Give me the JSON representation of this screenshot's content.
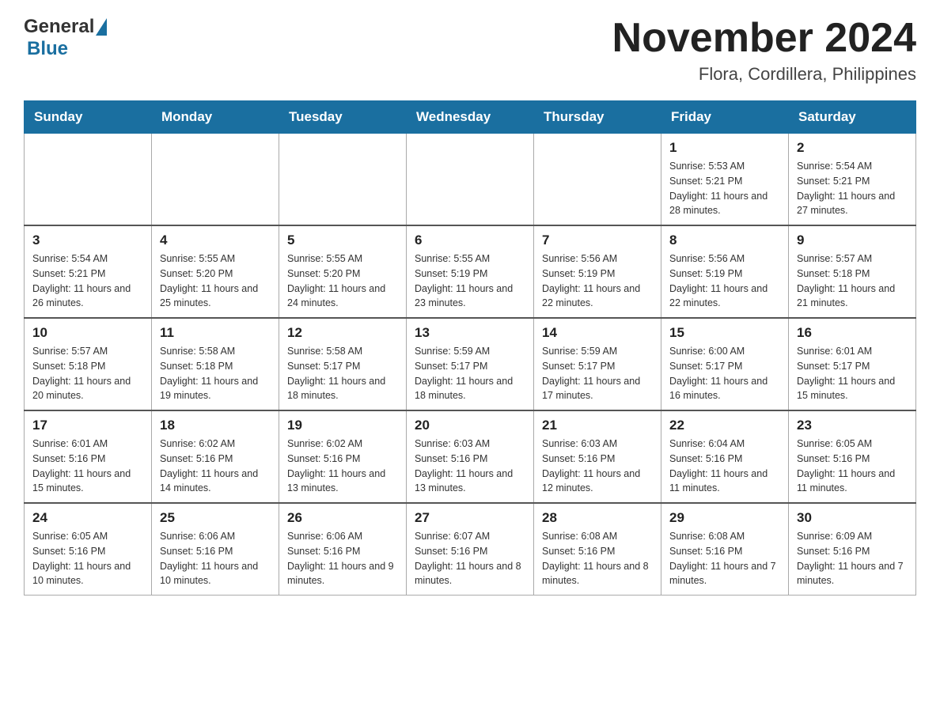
{
  "header": {
    "logo_general": "General",
    "logo_blue": "Blue",
    "month_title": "November 2024",
    "subtitle": "Flora, Cordillera, Philippines"
  },
  "weekdays": [
    "Sunday",
    "Monday",
    "Tuesday",
    "Wednesday",
    "Thursday",
    "Friday",
    "Saturday"
  ],
  "weeks": [
    [
      {
        "day": "",
        "info": ""
      },
      {
        "day": "",
        "info": ""
      },
      {
        "day": "",
        "info": ""
      },
      {
        "day": "",
        "info": ""
      },
      {
        "day": "",
        "info": ""
      },
      {
        "day": "1",
        "info": "Sunrise: 5:53 AM\nSunset: 5:21 PM\nDaylight: 11 hours and 28 minutes."
      },
      {
        "day": "2",
        "info": "Sunrise: 5:54 AM\nSunset: 5:21 PM\nDaylight: 11 hours and 27 minutes."
      }
    ],
    [
      {
        "day": "3",
        "info": "Sunrise: 5:54 AM\nSunset: 5:21 PM\nDaylight: 11 hours and 26 minutes."
      },
      {
        "day": "4",
        "info": "Sunrise: 5:55 AM\nSunset: 5:20 PM\nDaylight: 11 hours and 25 minutes."
      },
      {
        "day": "5",
        "info": "Sunrise: 5:55 AM\nSunset: 5:20 PM\nDaylight: 11 hours and 24 minutes."
      },
      {
        "day": "6",
        "info": "Sunrise: 5:55 AM\nSunset: 5:19 PM\nDaylight: 11 hours and 23 minutes."
      },
      {
        "day": "7",
        "info": "Sunrise: 5:56 AM\nSunset: 5:19 PM\nDaylight: 11 hours and 22 minutes."
      },
      {
        "day": "8",
        "info": "Sunrise: 5:56 AM\nSunset: 5:19 PM\nDaylight: 11 hours and 22 minutes."
      },
      {
        "day": "9",
        "info": "Sunrise: 5:57 AM\nSunset: 5:18 PM\nDaylight: 11 hours and 21 minutes."
      }
    ],
    [
      {
        "day": "10",
        "info": "Sunrise: 5:57 AM\nSunset: 5:18 PM\nDaylight: 11 hours and 20 minutes."
      },
      {
        "day": "11",
        "info": "Sunrise: 5:58 AM\nSunset: 5:18 PM\nDaylight: 11 hours and 19 minutes."
      },
      {
        "day": "12",
        "info": "Sunrise: 5:58 AM\nSunset: 5:17 PM\nDaylight: 11 hours and 18 minutes."
      },
      {
        "day": "13",
        "info": "Sunrise: 5:59 AM\nSunset: 5:17 PM\nDaylight: 11 hours and 18 minutes."
      },
      {
        "day": "14",
        "info": "Sunrise: 5:59 AM\nSunset: 5:17 PM\nDaylight: 11 hours and 17 minutes."
      },
      {
        "day": "15",
        "info": "Sunrise: 6:00 AM\nSunset: 5:17 PM\nDaylight: 11 hours and 16 minutes."
      },
      {
        "day": "16",
        "info": "Sunrise: 6:01 AM\nSunset: 5:17 PM\nDaylight: 11 hours and 15 minutes."
      }
    ],
    [
      {
        "day": "17",
        "info": "Sunrise: 6:01 AM\nSunset: 5:16 PM\nDaylight: 11 hours and 15 minutes."
      },
      {
        "day": "18",
        "info": "Sunrise: 6:02 AM\nSunset: 5:16 PM\nDaylight: 11 hours and 14 minutes."
      },
      {
        "day": "19",
        "info": "Sunrise: 6:02 AM\nSunset: 5:16 PM\nDaylight: 11 hours and 13 minutes."
      },
      {
        "day": "20",
        "info": "Sunrise: 6:03 AM\nSunset: 5:16 PM\nDaylight: 11 hours and 13 minutes."
      },
      {
        "day": "21",
        "info": "Sunrise: 6:03 AM\nSunset: 5:16 PM\nDaylight: 11 hours and 12 minutes."
      },
      {
        "day": "22",
        "info": "Sunrise: 6:04 AM\nSunset: 5:16 PM\nDaylight: 11 hours and 11 minutes."
      },
      {
        "day": "23",
        "info": "Sunrise: 6:05 AM\nSunset: 5:16 PM\nDaylight: 11 hours and 11 minutes."
      }
    ],
    [
      {
        "day": "24",
        "info": "Sunrise: 6:05 AM\nSunset: 5:16 PM\nDaylight: 11 hours and 10 minutes."
      },
      {
        "day": "25",
        "info": "Sunrise: 6:06 AM\nSunset: 5:16 PM\nDaylight: 11 hours and 10 minutes."
      },
      {
        "day": "26",
        "info": "Sunrise: 6:06 AM\nSunset: 5:16 PM\nDaylight: 11 hours and 9 minutes."
      },
      {
        "day": "27",
        "info": "Sunrise: 6:07 AM\nSunset: 5:16 PM\nDaylight: 11 hours and 8 minutes."
      },
      {
        "day": "28",
        "info": "Sunrise: 6:08 AM\nSunset: 5:16 PM\nDaylight: 11 hours and 8 minutes."
      },
      {
        "day": "29",
        "info": "Sunrise: 6:08 AM\nSunset: 5:16 PM\nDaylight: 11 hours and 7 minutes."
      },
      {
        "day": "30",
        "info": "Sunrise: 6:09 AM\nSunset: 5:16 PM\nDaylight: 11 hours and 7 minutes."
      }
    ]
  ]
}
